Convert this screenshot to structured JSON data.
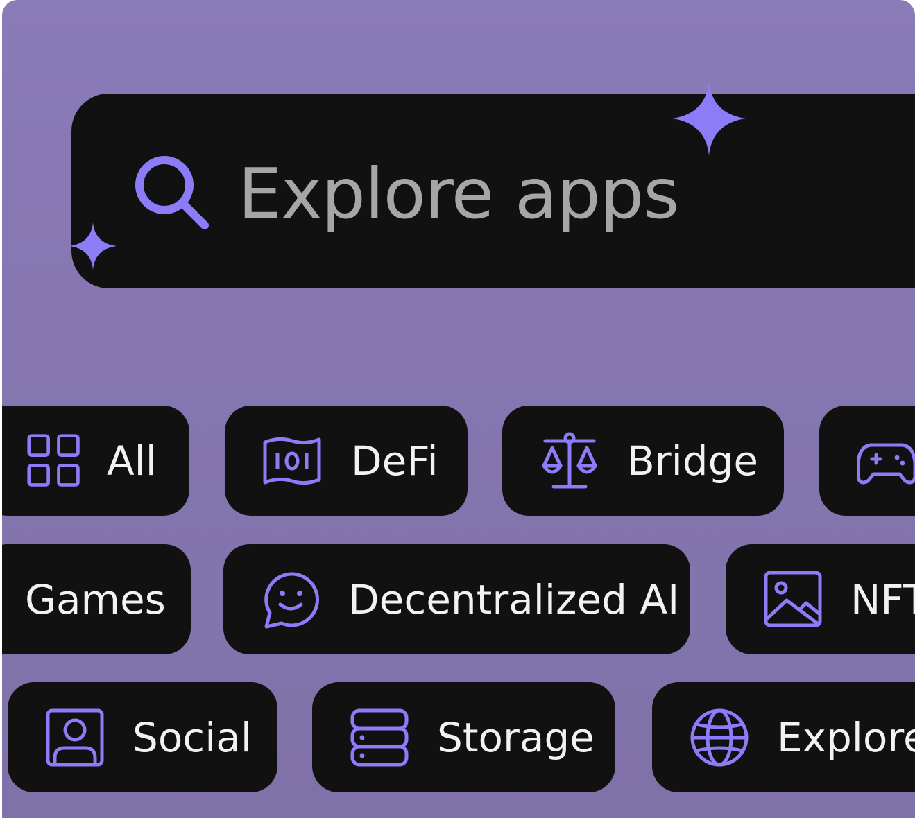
{
  "search": {
    "placeholder": "Explore apps"
  },
  "colors": {
    "background": "#8a7bb9",
    "chip": "#111111",
    "accent": "#8c7cf7",
    "placeholder": "#a6a6a6",
    "label": "#f2f2f2"
  },
  "categories": {
    "row1": [
      {
        "label": "All",
        "icon": "grid-icon"
      },
      {
        "label": "DeFi",
        "icon": "money-icon"
      },
      {
        "label": "Bridge",
        "icon": "scale-icon"
      },
      {
        "label": "",
        "icon": "gamepad-icon"
      }
    ],
    "row2": [
      {
        "label": "Games",
        "icon": ""
      },
      {
        "label": "Decentralized AI",
        "icon": "chat-smile-icon"
      },
      {
        "label": "NFT",
        "icon": "image-icon"
      }
    ],
    "row3": [
      {
        "label": "Social",
        "icon": "user-icon"
      },
      {
        "label": "Storage",
        "icon": "storage-icon"
      },
      {
        "label": "Explore",
        "icon": "globe-icon"
      }
    ]
  }
}
